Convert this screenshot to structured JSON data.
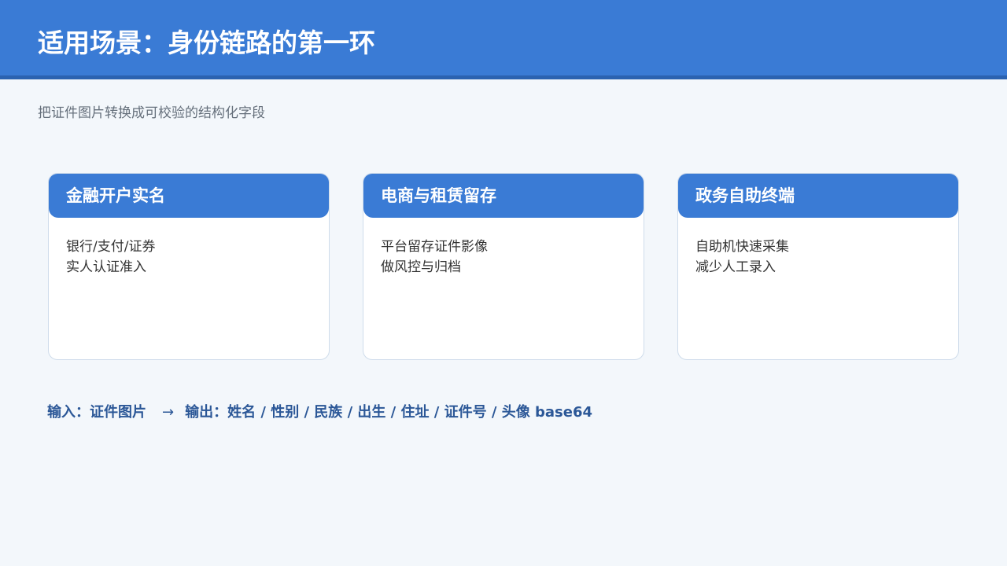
{
  "header": {
    "title": "适用场景：身份链路的第一环"
  },
  "subtitle": "把证件图片转换成可校验的结构化字段",
  "cards": [
    {
      "title": "金融开户实名",
      "lines": [
        "银行/支付/证券",
        "实人认证准入"
      ]
    },
    {
      "title": "电商与租赁留存",
      "lines": [
        "平台留存证件影像",
        "做风控与归档"
      ]
    },
    {
      "title": "政务自助终端",
      "lines": [
        "自助机快速采集",
        "减少人工录入"
      ]
    }
  ],
  "flow": {
    "input": "输入：证件图片",
    "arrow": "→",
    "output": "输出：姓名 / 性别 / 民族 / 出生 / 住址 / 证件号 / 头像 base64"
  },
  "colors": {
    "accent": "#3a7bd5",
    "accent_dark": "#2b62b0",
    "flow_text": "#2b5797",
    "background": "#f3f7fb"
  }
}
